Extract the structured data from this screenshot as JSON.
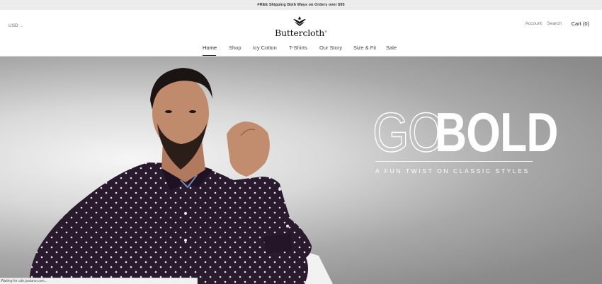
{
  "announcement": "FREE Shipping Both Ways on Orders over $95",
  "header": {
    "currency": "USD",
    "logo_text": "Buttercloth",
    "logo_mark": "®",
    "account": "Account",
    "search": "Search",
    "cart": "Cart (0)"
  },
  "nav": [
    {
      "label": "Home",
      "active": true
    },
    {
      "label": "Shop"
    },
    {
      "label": "Icy Cotton"
    },
    {
      "label": "T-Shirts"
    },
    {
      "label": "Our Story"
    },
    {
      "label": "Size & Fit"
    },
    {
      "label": "Sale"
    }
  ],
  "hero": {
    "headline_outline": "GO",
    "headline_solid": "BOLD",
    "tagline": "A FUN TWIST ON CLASSIC STYLES"
  },
  "status": "Waiting for cdn.justuno.com...",
  "colors": {
    "announce_bg": "#ececec",
    "shirt": "#2a1a2e",
    "hero_gray": "#9a9a9a"
  },
  "icons": {
    "currency_chevron": "chevron-down-icon",
    "logo": "leaf-crest-icon"
  }
}
